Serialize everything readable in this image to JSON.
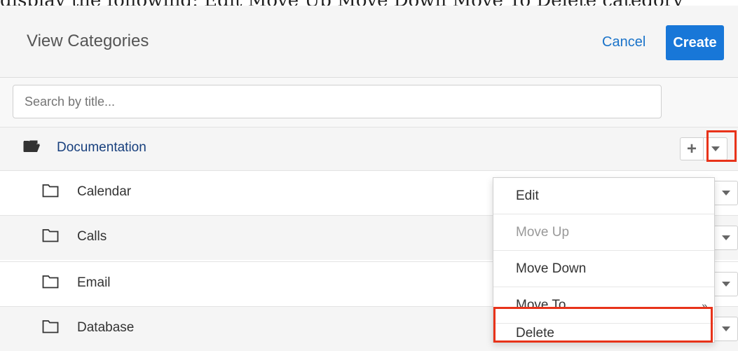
{
  "page": {
    "cutoff_text": "display the following: Edit Move Up Move Down Move To Delete category"
  },
  "header": {
    "title": "View Categories",
    "cancel_label": "Cancel",
    "create_label": "Create"
  },
  "search": {
    "placeholder": "Search by title..."
  },
  "tree": {
    "top": {
      "label": "Documentation",
      "icon": "folder-open-icon"
    },
    "children": [
      {
        "label": "Calendar",
        "icon": "folder-icon"
      },
      {
        "label": "Calls",
        "icon": "folder-icon"
      },
      {
        "label": "Email",
        "icon": "folder-icon"
      },
      {
        "label": "Database",
        "icon": "folder-icon"
      }
    ]
  },
  "menu": {
    "items": [
      {
        "label": "Edit"
      },
      {
        "label": "Move Up"
      },
      {
        "label": "Move Down"
      },
      {
        "label": "Move To",
        "arrow": "»"
      },
      {
        "label": "Delete"
      }
    ]
  },
  "colors": {
    "accent": "#1877d8",
    "link": "#173f7d",
    "highlight": "#e8331a"
  }
}
